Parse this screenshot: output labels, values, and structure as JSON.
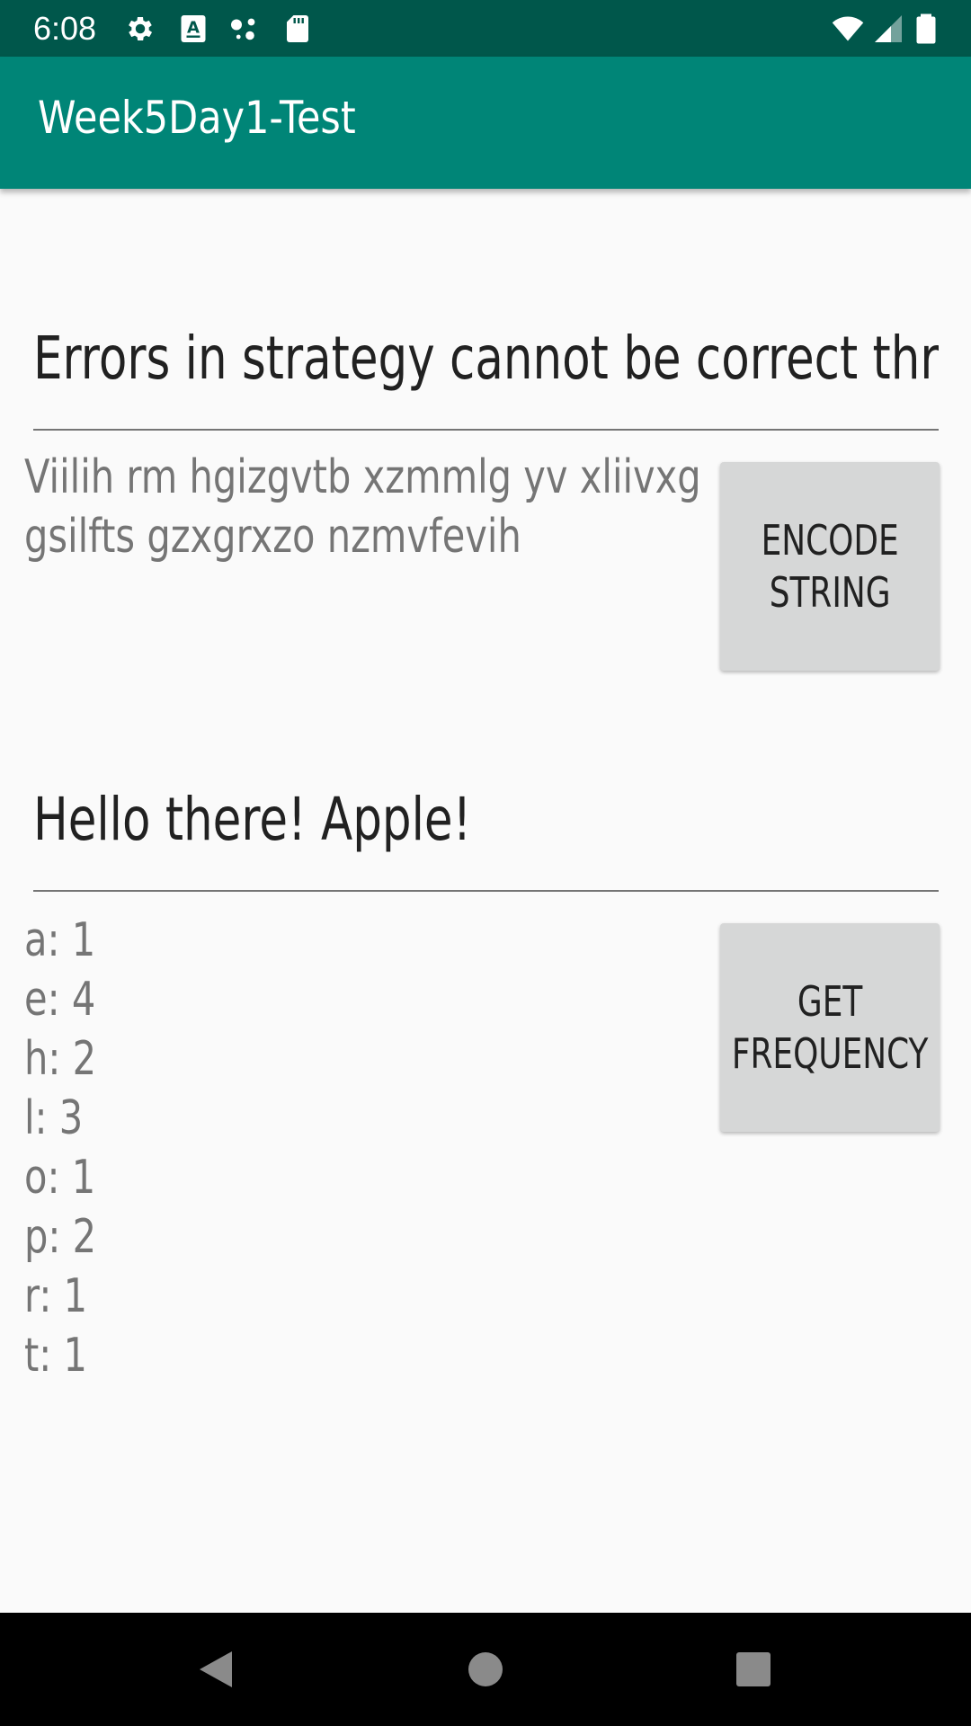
{
  "status_bar": {
    "time": "6:08",
    "icons_left": [
      "settings-icon",
      "text-recognition-icon",
      "assistant-dots-icon",
      "sd-card-icon"
    ],
    "icons_right": [
      "wifi-icon",
      "cell-signal-icon",
      "battery-icon"
    ]
  },
  "app_bar": {
    "title": "Week5Day1-Test"
  },
  "encode_section": {
    "input_value": "Errors in strategy cannot be correct thr",
    "output_lines": [
      "Viilih rm hgizgvtb xzmmlg yv xliivxg",
      "gsilfts gzxgrxzo nzmvfevih"
    ],
    "button_label": "ENCODE\nSTRING"
  },
  "frequency_section": {
    "input_value": "Hello there! Apple!",
    "output_lines": [
      "a: 1",
      "e: 4",
      "h: 2",
      "l: 3",
      "o: 1",
      "p: 2",
      "r: 1",
      "t: 1"
    ],
    "button_label": "GET\nFREQUENCY"
  },
  "nav_bar": {
    "buttons": [
      "back-icon",
      "home-icon",
      "recents-icon"
    ]
  },
  "colors": {
    "status_bar": "#00574b",
    "app_bar": "#008577",
    "background": "#fafafa",
    "button": "#d6d7d7",
    "text_primary": "#212121",
    "text_secondary": "#757575"
  }
}
